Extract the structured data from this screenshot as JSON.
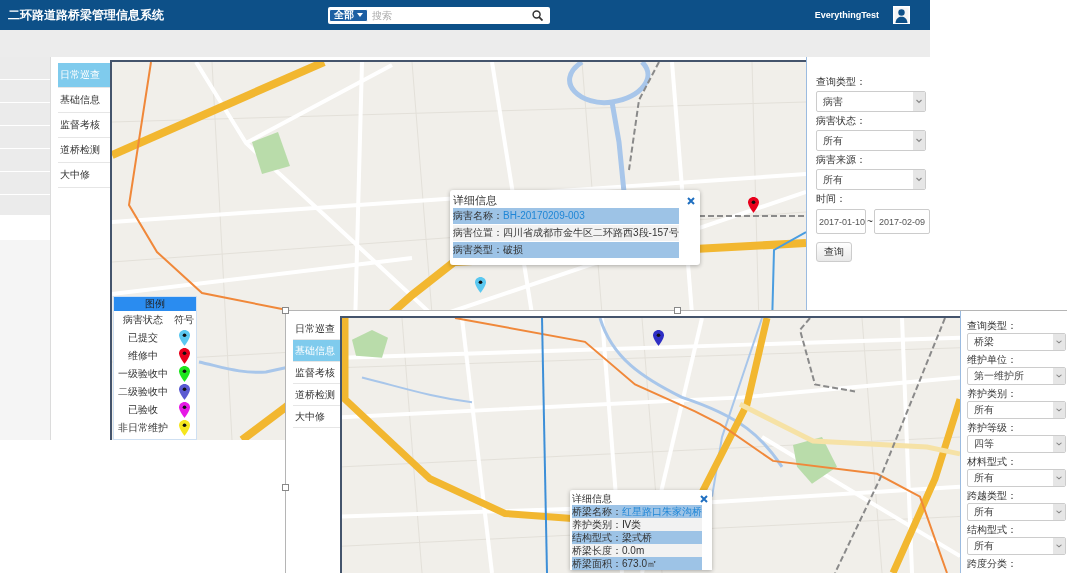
{
  "header": {
    "title": "二环路道路桥梁管理信息系统",
    "search": {
      "scope": "全部",
      "placeholder": "搜索"
    },
    "user": "EverythingTest"
  },
  "main_view": {
    "nav": [
      {
        "label": "日常巡查",
        "selected": true
      },
      {
        "label": "基础信息",
        "selected": false
      },
      {
        "label": "监督考核",
        "selected": false
      },
      {
        "label": "道桥检测",
        "selected": false
      },
      {
        "label": "大中修",
        "selected": false
      }
    ],
    "map": {
      "pins": [
        {
          "color": "#e8001c"
        },
        {
          "color": "#5bc8f0"
        }
      ],
      "popup": {
        "title": "详细信息",
        "rows": [
          {
            "label": "病害名称：",
            "value": "BH-20170209-003",
            "kind": "link",
            "highlighted": true
          },
          {
            "label": "病害位置：",
            "value": "四川省成都市金牛区二环路西3段-157号",
            "kind": "text",
            "highlighted": false
          },
          {
            "label": "病害类型：",
            "value": "破损",
            "kind": "text",
            "highlighted": true
          }
        ]
      },
      "legend": {
        "title": "图例",
        "columns": [
          "病害状态",
          "符号"
        ],
        "items": [
          {
            "label": "已提交",
            "color": "#5bc8f0"
          },
          {
            "label": "维修中",
            "color": "#e8001c"
          },
          {
            "label": "一级验收中",
            "color": "#1ee61e"
          },
          {
            "label": "二级验收中",
            "color": "#5a5ad2"
          },
          {
            "label": "已验收",
            "color": "#e619e6"
          },
          {
            "label": "非日常维护",
            "color": "#f5e61e"
          }
        ]
      }
    },
    "filters": [
      {
        "label": "查询类型：",
        "value": "病害"
      },
      {
        "label": "病害状态：",
        "value": "所有"
      },
      {
        "label": "病害来源：",
        "value": "所有"
      }
    ],
    "date_range": {
      "label": "时间：",
      "from": "2017-01-10",
      "separator": "~",
      "to": "2017-02-09"
    },
    "query_button": "查询"
  },
  "overlay_view": {
    "nav": [
      {
        "label": "日常巡查",
        "selected": false
      },
      {
        "label": "基础信息",
        "selected": true
      },
      {
        "label": "监督考核",
        "selected": false
      },
      {
        "label": "道桥检测",
        "selected": false
      },
      {
        "label": "大中修",
        "selected": false
      }
    ],
    "map": {
      "pins": [
        {
          "color": "#2f2fc4"
        }
      ],
      "popup": {
        "title": "详细信息",
        "rows": [
          {
            "label": "桥梁名称：",
            "value": "红星路口朱家沟桥",
            "kind": "link",
            "highlighted": true
          },
          {
            "label": "养护类别：",
            "value": "Ⅳ类",
            "kind": "text",
            "highlighted": false
          },
          {
            "label": "结构型式：",
            "value": "梁式桥",
            "kind": "text",
            "highlighted": true
          },
          {
            "label": "桥梁长度：",
            "value": "0.0m",
            "kind": "text",
            "highlighted": false
          },
          {
            "label": "桥梁面积：",
            "value": "673.0㎡",
            "kind": "text",
            "highlighted": true
          }
        ]
      }
    },
    "filters": [
      {
        "label": "查询类型：",
        "value": "桥梁"
      },
      {
        "label": "维护单位：",
        "value": "第一维护所"
      },
      {
        "label": "养护类别：",
        "value": "所有"
      },
      {
        "label": "养护等级：",
        "value": "四等"
      },
      {
        "label": "材料型式：",
        "value": "所有"
      },
      {
        "label": "跨越类型：",
        "value": "所有"
      },
      {
        "label": "结构型式：",
        "value": "所有"
      },
      {
        "label": "跨度分类："
      }
    ]
  }
}
